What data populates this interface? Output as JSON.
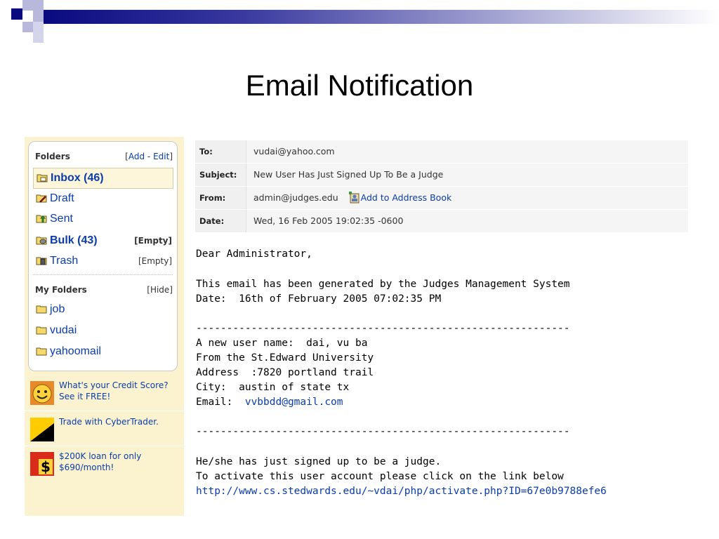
{
  "slide": {
    "title": "Email Notification"
  },
  "sidebar": {
    "folders_heading": "Folders",
    "add_edit_open": "[",
    "add_label": "Add",
    "add_edit_sep": " - ",
    "edit_label": "Edit",
    "add_edit_close": "]",
    "folders": [
      {
        "label": "Inbox (46)",
        "icon": "inbox-icon"
      },
      {
        "label": "Draft",
        "icon": "draft-icon"
      },
      {
        "label": "Sent",
        "icon": "sent-icon"
      },
      {
        "label": "Bulk (43)",
        "icon": "bulk-icon",
        "action": "[Empty]"
      },
      {
        "label": "Trash",
        "icon": "trash-icon",
        "action": "[Empty]"
      }
    ],
    "my_folders_heading": "My Folders",
    "hide_label": "[Hide]",
    "my_folders": [
      {
        "label": "job",
        "icon": "folder-icon"
      },
      {
        "label": "vudai",
        "icon": "folder-icon"
      },
      {
        "label": "yahoomail",
        "icon": "folder-icon"
      }
    ],
    "ads": [
      {
        "text": "What's your Credit Score? See it FREE!",
        "icon": "smiley-icon"
      },
      {
        "text": "Trade with CyberTrader.",
        "icon": "cybertrader-icon"
      },
      {
        "text": "$200K loan for only $690/month!",
        "icon": "dollar-icon"
      }
    ]
  },
  "header": {
    "to_label": "To:",
    "to_value": "vudai@yahoo.com",
    "subject_label": "Subject:",
    "subject_value": "New User Has Just Signed Up To Be a Judge",
    "from_label": "From:",
    "from_value": "admin@judges.edu",
    "add_address_book": "Add to Address Book",
    "date_label": "Date:",
    "date_value": "Wed, 16 Feb 2005 19:02:35 -0600"
  },
  "body": {
    "greeting": "Dear Administrator,",
    "line1": "This email has been generated by the Judges Management System",
    "line2": "Date:  16th of February 2005 07:02:35 PM",
    "separator1": "-------------------------------------------------------------",
    "user_name": "A new user name:  dai, vu ba",
    "university": "From the St.Edward University",
    "address": "Address  :7820 portland trail",
    "city": "City:  austin of state tx",
    "email_label": "Email:  ",
    "email_value": "vvbbdd@gmail.com",
    "separator2": "-------------------------------------------------------------",
    "signed_up": "He/she has just signed up to be a judge.",
    "activate": "To activate this user account please click on the link below",
    "activate_link": "http://www.cs.stedwards.edu/~vdai/php/activate.php?ID=67e0b9788efe6"
  }
}
